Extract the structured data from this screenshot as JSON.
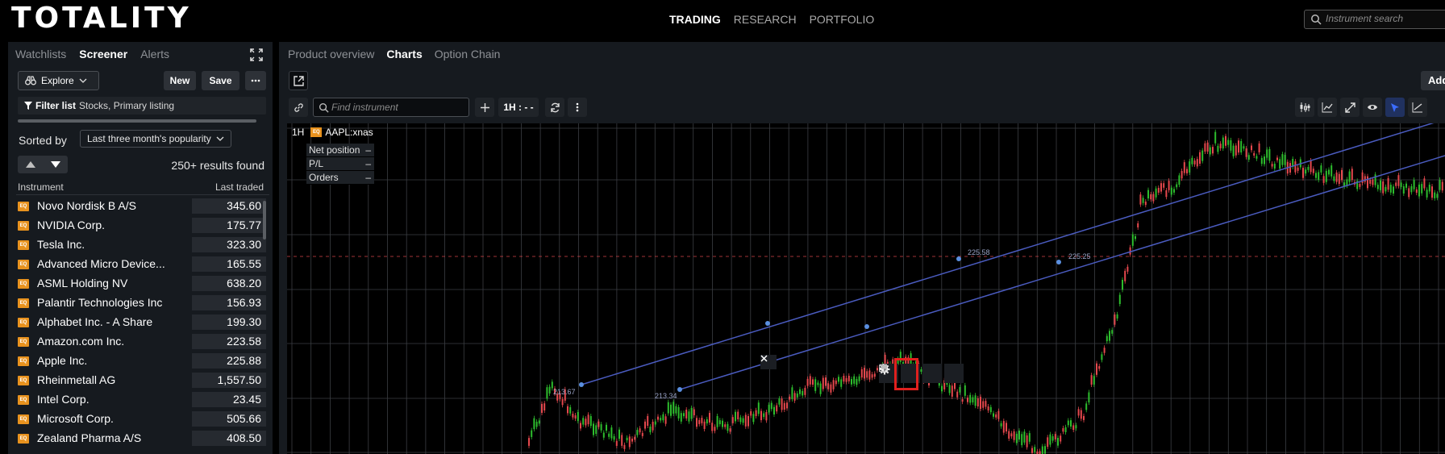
{
  "app": {
    "logo": "TOTALITY"
  },
  "nav": [
    {
      "label": "TRADING",
      "active": true
    },
    {
      "label": "RESEARCH",
      "active": false
    },
    {
      "label": "PORTFOLIO",
      "active": false
    }
  ],
  "search": {
    "placeholder": "Instrument search"
  },
  "left": {
    "tabs": [
      {
        "label": "Watchlists",
        "active": false
      },
      {
        "label": "Screener",
        "active": true
      },
      {
        "label": "Alerts",
        "active": false
      }
    ],
    "explore_label": "Explore",
    "new_label": "New",
    "save_label": "Save",
    "filter_label": "Filter list",
    "filter_value": "Stocks, Primary listing",
    "sorted_by": "Sorted by",
    "sort_option": "Last three month's popularity",
    "results": "250+ results found",
    "col_instrument": "Instrument",
    "col_last": "Last traded",
    "eq_badge": "EQ",
    "rows": [
      {
        "name": "Novo Nordisk B A/S",
        "price": "345.60"
      },
      {
        "name": "NVIDIA Corp.",
        "price": "175.77"
      },
      {
        "name": "Tesla Inc.",
        "price": "323.30"
      },
      {
        "name": "Advanced Micro Device...",
        "price": "165.55"
      },
      {
        "name": "ASML Holding NV",
        "price": "638.20"
      },
      {
        "name": "Palantir Technologies Inc",
        "price": "156.93"
      },
      {
        "name": "Alphabet Inc. - A Share",
        "price": "199.30"
      },
      {
        "name": "Amazon.com Inc.",
        "price": "223.58"
      },
      {
        "name": "Apple Inc.",
        "price": "225.88"
      },
      {
        "name": "Rheinmetall AG",
        "price": "1,557.50"
      },
      {
        "name": "Intel Corp.",
        "price": "23.45"
      },
      {
        "name": "Microsoft Corp.",
        "price": "505.66"
      },
      {
        "name": "Zealand Pharma A/S",
        "price": "408.50"
      }
    ]
  },
  "right": {
    "tabs": [
      {
        "label": "Product overview",
        "active": false
      },
      {
        "label": "Charts",
        "active": true
      },
      {
        "label": "Option Chain",
        "active": false
      }
    ],
    "add_label": "Add",
    "find_placeholder": "Find instrument",
    "timeframe": "1H : - -",
    "chart_interval": "1H",
    "ticker": "AAPL:xnas",
    "position": [
      {
        "label": "Net position",
        "value": "–"
      },
      {
        "label": "P/L",
        "value": "–"
      },
      {
        "label": "Orders",
        "value": "–"
      }
    ],
    "level_labels": [
      "213.67",
      "213.34",
      "225.58",
      "225.25"
    ],
    "colors": {
      "up": "#2dbd2d",
      "down": "#e5484d",
      "trendline": "#4a5bbf",
      "highlight": "#e0201e"
    }
  }
}
